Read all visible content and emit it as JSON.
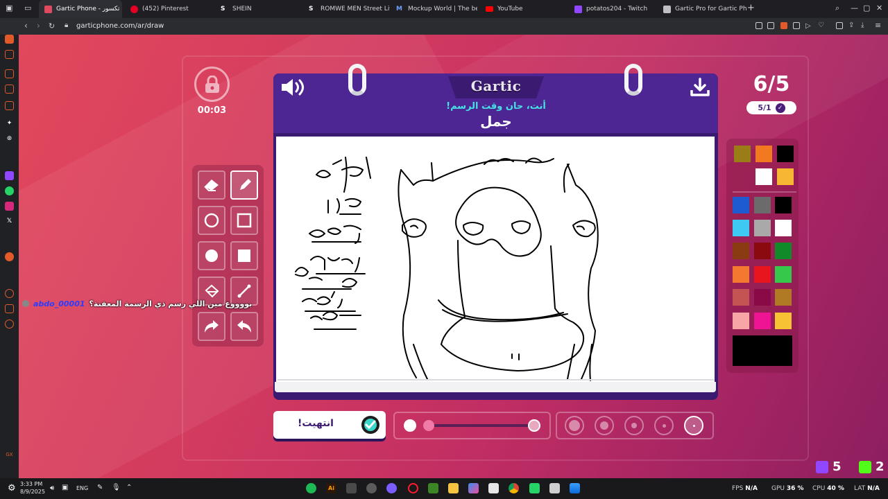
{
  "browser": {
    "tabs": [
      {
        "label": "Gartic Phone - تكسور",
        "active": true,
        "favicon_color": "#e04a5f"
      },
      {
        "label": "(452) Pinterest",
        "favicon_color": "#e60023"
      },
      {
        "label": "SHEIN",
        "favicon_color": "#111111"
      },
      {
        "label": "ROMWE MEN Street Life",
        "favicon_color": "#111111"
      },
      {
        "label": "Mockup World | The best",
        "favicon_color": "#2a55c8"
      },
      {
        "label": "YouTube",
        "favicon_color": "#ff0000"
      },
      {
        "label": "potatos204 - Twitch",
        "favicon_color": "#9146ff"
      },
      {
        "label": "Gartic Pro for Gartic Phon",
        "favicon_color": "#bfbfc4"
      }
    ],
    "new_tab": "+",
    "url": "garticphone.com/ar/draw"
  },
  "game": {
    "timer": "00:03",
    "round": "6/5",
    "done_count": "5/1",
    "logo": "Gartic",
    "subtitle": "أنت، حان وقت الرسم!",
    "word": "جمل",
    "done_button": "انتهيت!",
    "palette_colors": [
      "#9a7d16",
      "#f2791f",
      "#000000",
      "#ffffff",
      "#f7b733",
      "#1e5bd0",
      "#6b6b6b",
      "#000000",
      "#3ec9f2",
      "#a9a9a9",
      "#ffffff",
      "#8a3b12",
      "#8a0a10",
      "#118a2a",
      "#f2792f",
      "#e8141e",
      "#35c84a",
      "#c45454",
      "#8a0a47",
      "#b07a25",
      "#f7a5a5",
      "#ee1493",
      "#f7c233"
    ],
    "current_color": "#000000"
  },
  "chat": {
    "username": "abdo_00001",
    "message": "بووووع مين اللي رسم ذي الرسمة المعفنة؟"
  },
  "corner_stats": {
    "twitch_count": "5",
    "kick_count": "2"
  },
  "taskbar": {
    "time": "3:33 PM",
    "date": "8/9/2025",
    "lang": "ENG",
    "fps_label": "FPS",
    "fps_value": "N/A",
    "gpu_label": "GPU",
    "gpu_value": "36 %",
    "cpu_label": "CPU",
    "cpu_value": "40 %",
    "lat_label": "LAT",
    "lat_value": "N/A"
  }
}
